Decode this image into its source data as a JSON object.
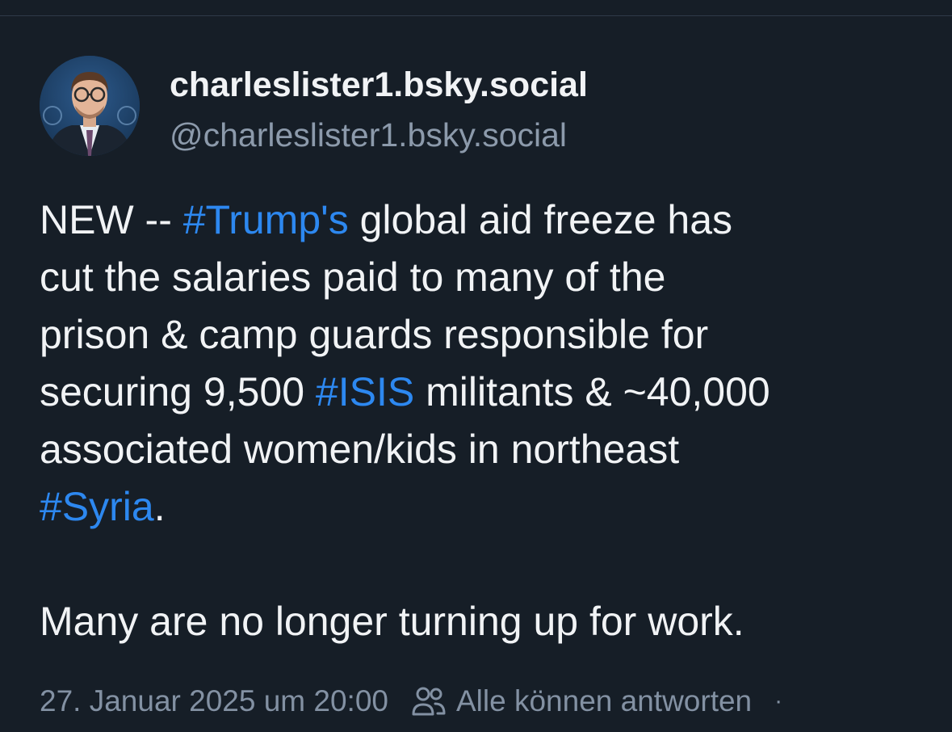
{
  "author": {
    "display_name": "charleslister1.bsky.social",
    "handle": "@charleslister1.bsky.social"
  },
  "post": {
    "lines": [
      [
        {
          "text": "NEW -- "
        },
        {
          "text": "#Trump's",
          "hashtag": true
        },
        {
          "text": " global aid freeze has"
        }
      ],
      [
        {
          "text": "cut the salaries paid to many of the"
        }
      ],
      [
        {
          "text": "prison & camp guards responsible for"
        }
      ],
      [
        {
          "text": "securing 9,500 "
        },
        {
          "text": "#ISIS",
          "hashtag": true
        },
        {
          "text": " militants & ~40,000"
        }
      ],
      [
        {
          "text": "associated women/kids in northeast"
        }
      ],
      [
        {
          "text": "#Syria",
          "hashtag": true
        },
        {
          "text": "."
        }
      ],
      [],
      [
        {
          "text": "Many are no longer turning up for work."
        }
      ]
    ]
  },
  "meta": {
    "timestamp": "27. Januar 2025 um 20:00",
    "reply_icon": "people-icon",
    "reply_setting": "Alle können antworten",
    "separator": "·"
  },
  "colors": {
    "background": "#161e27",
    "text": "#f1f3f5",
    "muted": "#8c9aab",
    "hashtag": "#2d88f0"
  }
}
